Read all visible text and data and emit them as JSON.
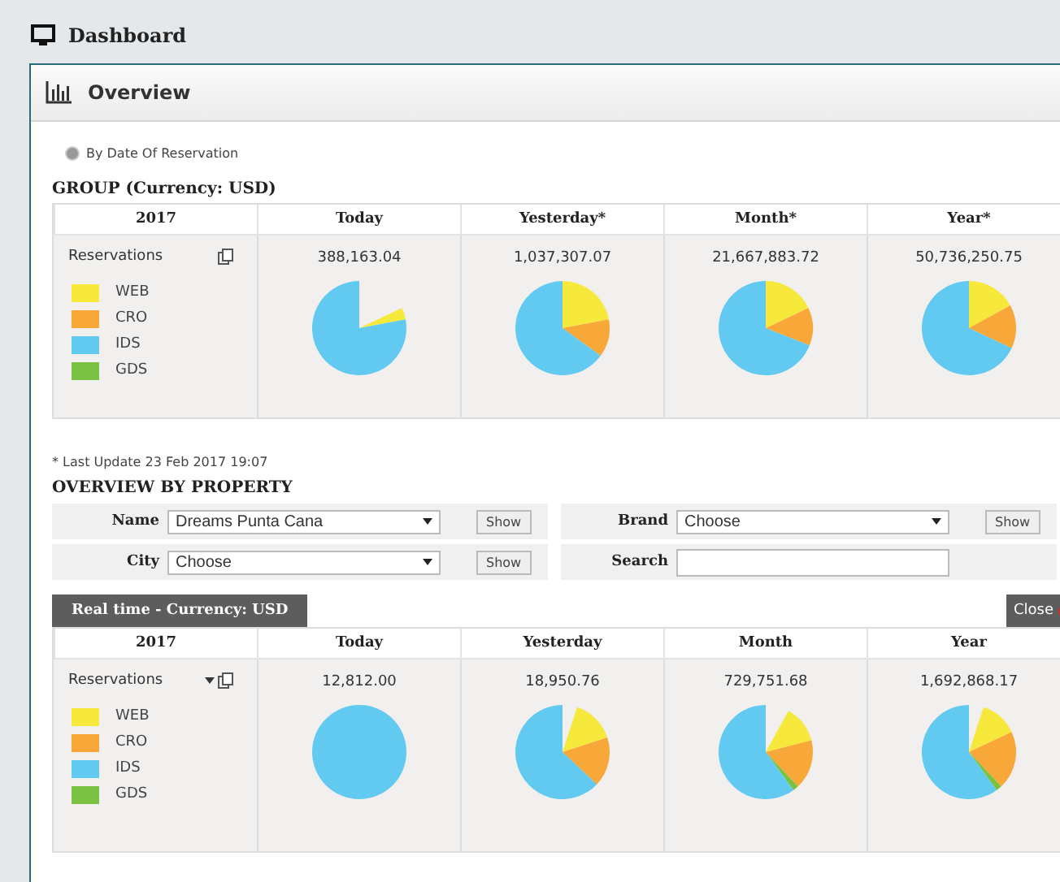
{
  "header": {
    "title": "Dashboard"
  },
  "panel": {
    "title": "Overview"
  },
  "date_filter": {
    "label": "By Date Of Reservation",
    "selected": true
  },
  "group": {
    "title": "GROUP (Currency: USD)",
    "columns": [
      "2017",
      "Today",
      "Yesterday*",
      "Month*",
      "Year*"
    ],
    "row_label": "Reservations",
    "values": [
      "388,163.04",
      "1,037,307.07",
      "21,667,883.72",
      "50,736,250.75"
    ],
    "legend": [
      {
        "label": "WEB",
        "color": "#f7e93b"
      },
      {
        "label": "CRO",
        "color": "#f7a839"
      },
      {
        "label": "IDS",
        "color": "#62c9f0"
      },
      {
        "label": "GDS",
        "color": "#7cc242"
      }
    ]
  },
  "last_update": "* Last Update 23 Feb 2017 19:07",
  "property": {
    "title": "OVERVIEW BY PROPERTY",
    "filters": [
      {
        "kind": "select",
        "label": "Name",
        "value": "Dreams Punta Cana",
        "button": "Show"
      },
      {
        "kind": "select",
        "label": "Brand",
        "value": "Choose",
        "button": "Show"
      },
      {
        "kind": "select",
        "label": "City",
        "value": "Choose",
        "button": "Show"
      },
      {
        "kind": "text",
        "label": "Search"
      }
    ]
  },
  "realtime": {
    "title": "Real time - Currency: USD",
    "close": "Close",
    "columns": [
      "2017",
      "Today",
      "Yesterday",
      "Month",
      "Year"
    ],
    "row_label": "Reservations",
    "values": [
      "12,812.00",
      "18,950.76",
      "729,751.68",
      "1,692,868.17"
    ],
    "legend": [
      {
        "label": "WEB",
        "color": "#f7e93b"
      },
      {
        "label": "CRO",
        "color": "#f7a839"
      },
      {
        "label": "IDS",
        "color": "#62c9f0"
      },
      {
        "label": "GDS",
        "color": "#7cc242"
      }
    ]
  }
}
